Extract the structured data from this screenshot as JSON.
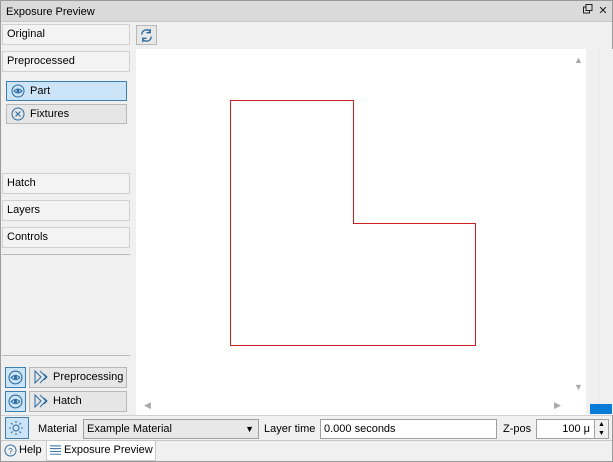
{
  "window": {
    "title": "Exposure Preview",
    "float_icon": "float-icon",
    "close_icon": "close-icon"
  },
  "left": {
    "sections": {
      "original": "Original",
      "preprocessed": "Preprocessed",
      "hatch": "Hatch",
      "layers": "Layers",
      "controls": "Controls"
    },
    "filters": [
      {
        "label": "Part",
        "icon": "eye-icon",
        "active": true
      },
      {
        "label": "Fixtures",
        "icon": "x-circle-icon",
        "active": false
      }
    ],
    "bottom_rows": [
      {
        "toggle_icon": "eye-icon",
        "label": "Preprocessing",
        "icon": "play-steps-icon"
      },
      {
        "toggle_icon": "eye-icon",
        "label": "Hatch",
        "icon": "play-steps-icon"
      }
    ]
  },
  "toolbar": {
    "refresh_icon": "refresh-icon"
  },
  "canvas": {
    "shape": "L-shaped part outline",
    "stroke_color": "#cc1f1f"
  },
  "bottom": {
    "settings_icon": "gear-icon",
    "material_label": "Material",
    "material_value": "Example Material",
    "layer_time_label": "Layer time",
    "layer_time_value": "0.000 seconds",
    "zpos_label": "Z-pos",
    "zpos_value": "100 μ"
  },
  "tabs": [
    {
      "label": "Help",
      "icon": "help-icon",
      "active": false
    },
    {
      "label": "Exposure Preview",
      "icon": "layers-icon",
      "active": true
    }
  ],
  "colors": {
    "accent": "#3c7fb1",
    "active_bg": "#cce4f7",
    "progress": "#0a7bd8"
  }
}
